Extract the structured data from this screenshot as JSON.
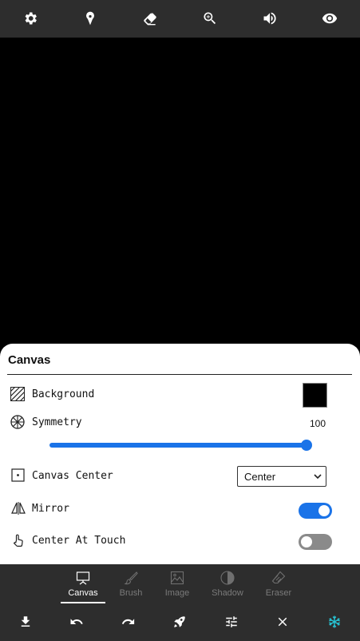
{
  "panel": {
    "title": "Canvas",
    "rows": {
      "background": {
        "label": "Background",
        "swatch_color": "#000000"
      },
      "symmetry": {
        "label": "Symmetry",
        "value": "100",
        "slider_fraction": 1.0
      },
      "canvas_center": {
        "label": "Canvas Center",
        "selected": "Center"
      },
      "mirror": {
        "label": "Mirror",
        "on": true
      },
      "center_at_touch": {
        "label": "Center At Touch",
        "on": false
      }
    }
  },
  "tabs": [
    {
      "label": "Canvas",
      "icon": "easel-icon",
      "active": true
    },
    {
      "label": "Brush",
      "icon": "brush-icon",
      "active": false
    },
    {
      "label": "Image",
      "icon": "image-icon",
      "active": false
    },
    {
      "label": "Shadow",
      "icon": "shadow-icon",
      "active": false
    },
    {
      "label": "Eraser",
      "icon": "eraser-icon",
      "active": false
    }
  ],
  "top_toolbar_icons": [
    "gear-icon",
    "brush-drop-icon",
    "eraser-icon",
    "zoom-in-icon",
    "volume-icon",
    "eye-icon"
  ],
  "bottom_toolbar_icons": [
    "download-icon",
    "undo-icon",
    "redo-icon",
    "rocket-icon",
    "sliders-icon",
    "close-icon",
    "snowflake-icon"
  ],
  "colors": {
    "accent": "#1a73e8",
    "snowflake": "#27c4d4",
    "bars": "#2d2d2d"
  }
}
